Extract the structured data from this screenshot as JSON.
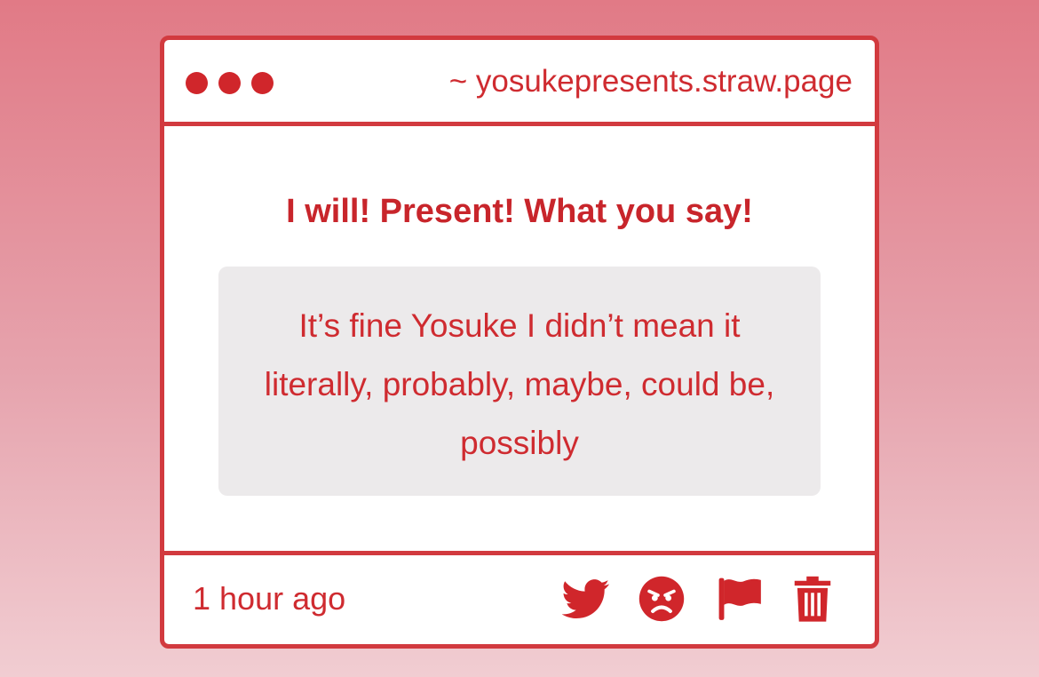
{
  "window": {
    "url": "~ yosukepresents.straw.page"
  },
  "post": {
    "question": "I will! Present! What you say!",
    "answer": "It’s fine Yosuke I didn’t mean it literally, probably, maybe, could be, possibly"
  },
  "footer": {
    "timestamp": "1 hour ago",
    "icons": [
      "twitter-icon",
      "angry-face-icon",
      "flag-icon",
      "trash-icon"
    ]
  },
  "colors": {
    "accent": "#d23a3f",
    "text": "#cf2b30",
    "answer_bg": "#eceaeb"
  }
}
